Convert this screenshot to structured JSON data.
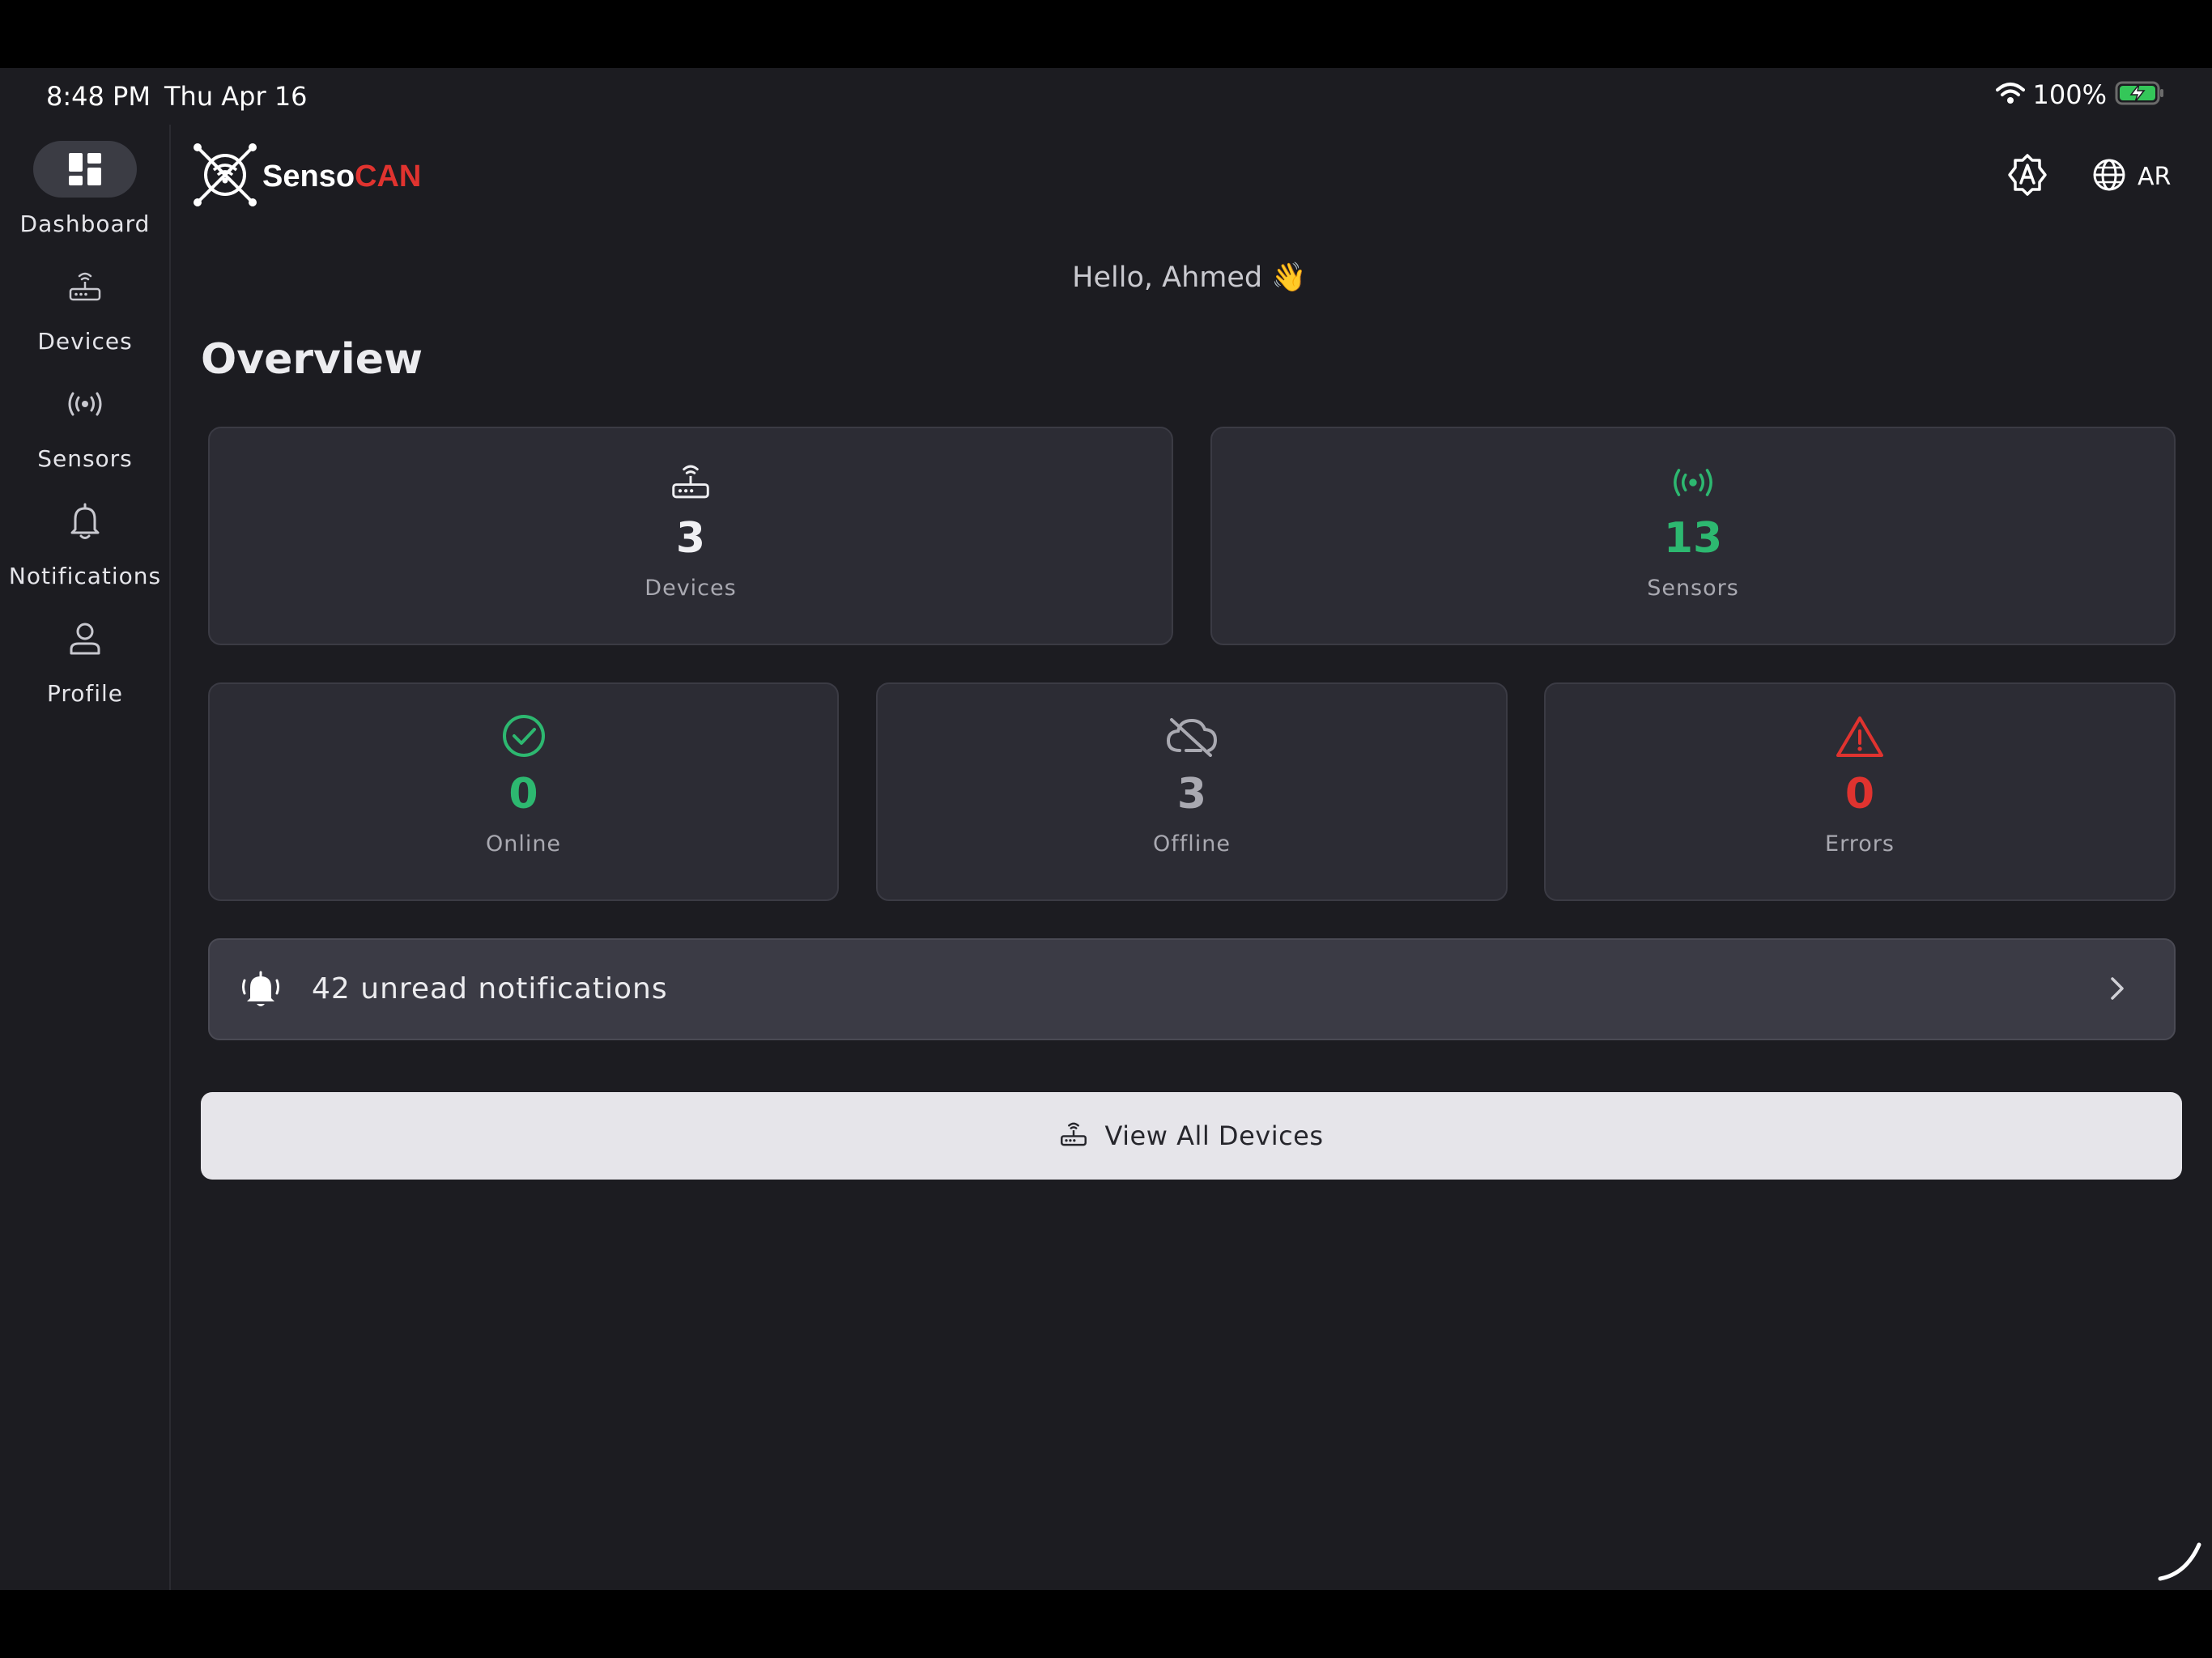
{
  "status_bar": {
    "time": "8:48 PM",
    "date": "Thu Apr 16",
    "battery": "100%"
  },
  "sidebar": {
    "items": [
      {
        "label": "Dashboard",
        "icon": "dashboard-icon",
        "active": true
      },
      {
        "label": "Devices",
        "icon": "router-icon",
        "active": false
      },
      {
        "label": "Sensors",
        "icon": "broadcast-icon",
        "active": false
      },
      {
        "label": "Notifications",
        "icon": "bell-icon",
        "active": false
      },
      {
        "label": "Profile",
        "icon": "person-icon",
        "active": false
      }
    ]
  },
  "header": {
    "logo_part1": "Senso",
    "logo_part2": "CAN",
    "language": "AR"
  },
  "greeting": "Hello, Ahmed 👋",
  "title": "Overview",
  "stats": {
    "devices": {
      "value": "3",
      "label": "Devices"
    },
    "sensors": {
      "value": "13",
      "label": "Sensors"
    },
    "online": {
      "value": "0",
      "label": "Online"
    },
    "offline": {
      "value": "3",
      "label": "Offline"
    },
    "errors": {
      "value": "0",
      "label": "Errors"
    }
  },
  "notifications": {
    "text": "42 unread notifications"
  },
  "view_all_button": "View All Devices",
  "colors": {
    "background": "#1c1c21",
    "card": "#2c2c34",
    "green": "#2db870",
    "red": "#e0332f",
    "muted": "#a9a9b1"
  }
}
